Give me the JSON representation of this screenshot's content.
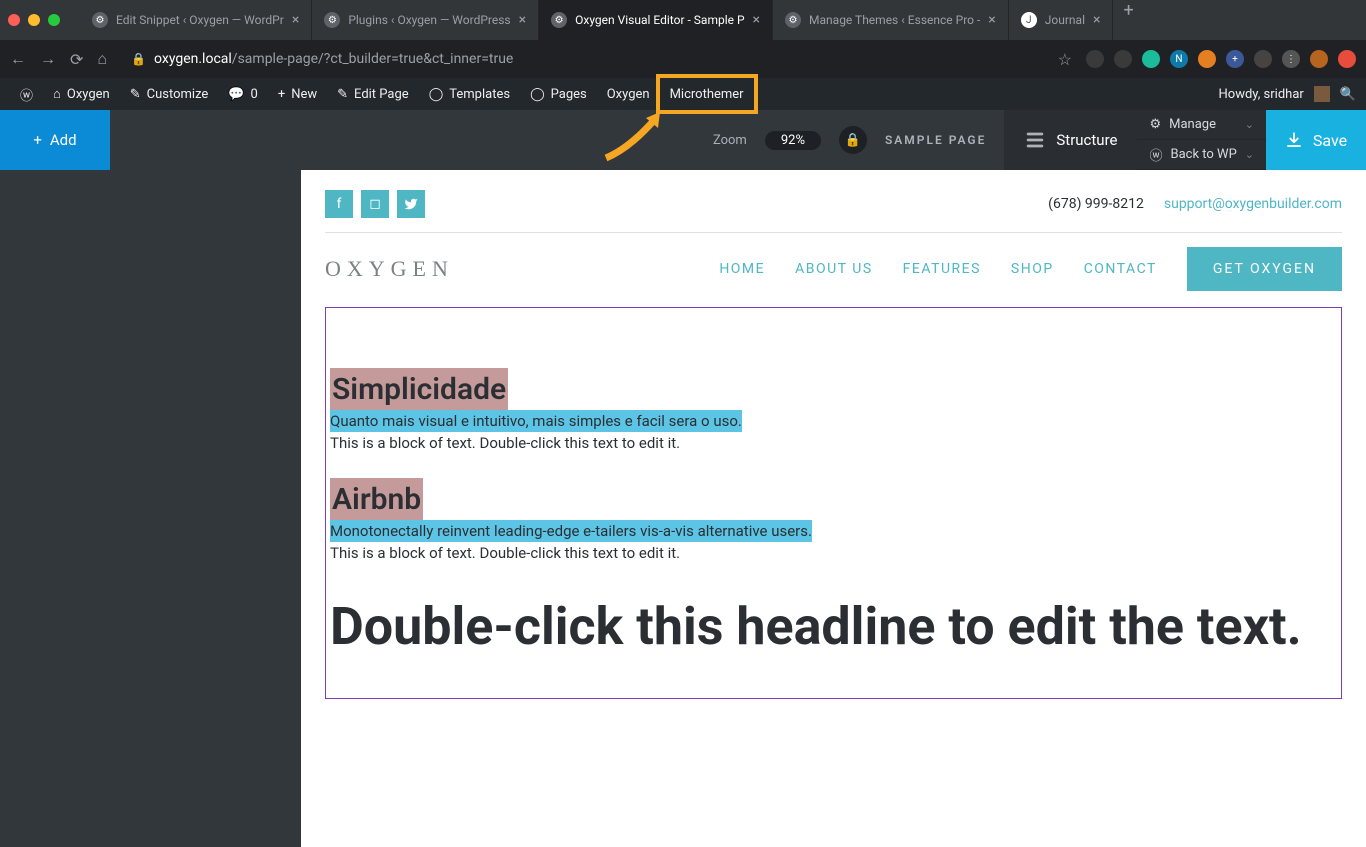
{
  "browser": {
    "tabs": [
      {
        "title": "Edit Snippet ‹ Oxygen — WordPr"
      },
      {
        "title": "Plugins ‹ Oxygen — WordPress"
      },
      {
        "title": "Oxygen Visual Editor - Sample P",
        "active": true
      },
      {
        "title": "Manage Themes ‹ Essence Pro -"
      },
      {
        "title": "Journal"
      }
    ],
    "url_domain": "oxygen.local",
    "url_path": "/sample-page/?ct_builder=true&ct_inner=true"
  },
  "wpbar": {
    "site": "Oxygen",
    "customize": "Customize",
    "comments": "0",
    "new": "New",
    "edit_page": "Edit Page",
    "templates": "Templates",
    "pages": "Pages",
    "oxygen": "Oxygen",
    "microthemer": "Microthemer",
    "howdy": "Howdy, sridhar"
  },
  "toolbar": {
    "add": "Add",
    "zoom_label": "Zoom",
    "zoom_value": "92%",
    "page_name": "SAMPLE PAGE",
    "structure": "Structure",
    "manage": "Manage",
    "back_to_wp": "Back to WP",
    "save": "Save"
  },
  "site": {
    "phone": "(678) 999-8212",
    "email": "support@oxygenbuilder.com",
    "logo": "OXYGEN",
    "nav": [
      "HOME",
      "ABOUT US",
      "FEATURES",
      "SHOP",
      "CONTACT"
    ],
    "cta": "GET OXYGEN"
  },
  "content": {
    "block1": {
      "heading": "Simplicidade",
      "sub": "Quanto mais visual e intuitivo, mais simples e facil sera o uso.",
      "para": "This is a block of text. Double-click this text to edit it."
    },
    "block2": {
      "heading": "Airbnb",
      "sub": "Monotonectally reinvent leading-edge e-tailers vis-a-vis alternative users.",
      "para": "This is a block of text. Double-click this text to edit it."
    },
    "headline": "Double-click this headline to edit the text."
  }
}
